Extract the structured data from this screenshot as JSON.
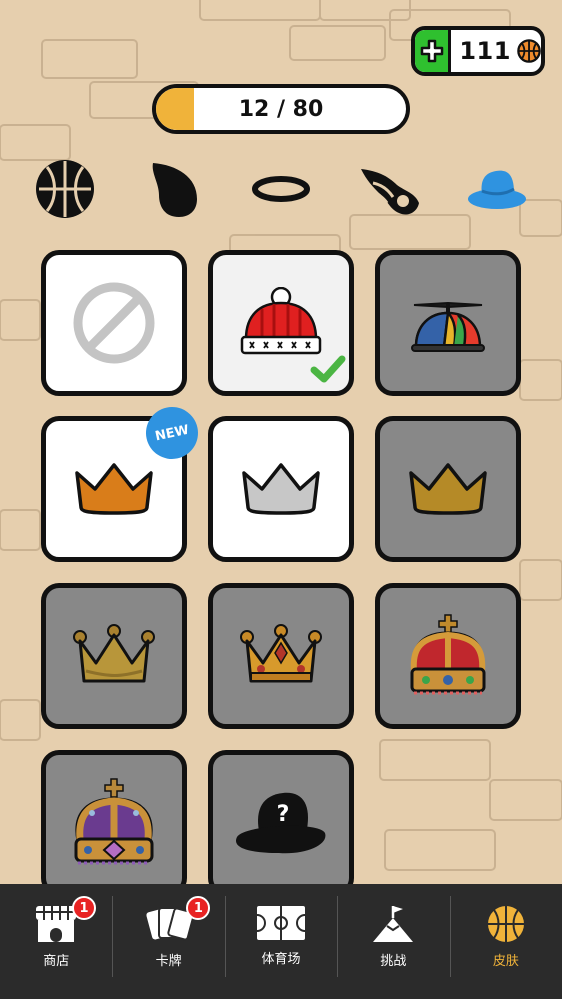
{
  "currency": {
    "amount": "111",
    "plus_icon": "plus-icon",
    "coin_icon": "basketball-icon"
  },
  "progress": {
    "text": "12 / 80",
    "collected": 12,
    "total": 80,
    "fill_color": "#f0b33a"
  },
  "categories": [
    {
      "name": "ball",
      "icon": "basketball-icon"
    },
    {
      "name": "shadow",
      "icon": "drop-shadow-icon"
    },
    {
      "name": "hoop",
      "icon": "ring-icon"
    },
    {
      "name": "fire",
      "icon": "flame-trail-icon"
    },
    {
      "name": "hat",
      "icon": "hat-icon",
      "selected": true,
      "selected_color": "#2f93e0"
    }
  ],
  "skins": [
    {
      "name": "none",
      "icon": "no-symbol-icon",
      "locked": false
    },
    {
      "name": "red-beanie",
      "icon": "beanie-icon",
      "locked": false,
      "equipped": true
    },
    {
      "name": "propeller-cap",
      "icon": "propeller-cap-icon",
      "locked": true
    },
    {
      "name": "orange-crown",
      "icon": "crown-icon",
      "locked": false,
      "new_badge": "NEW"
    },
    {
      "name": "silver-crown",
      "icon": "crown-icon",
      "locked": false
    },
    {
      "name": "gold-crown",
      "icon": "crown-icon",
      "locked": true
    },
    {
      "name": "ball-crown",
      "icon": "crown-icon",
      "locked": true
    },
    {
      "name": "jeweled-crown",
      "icon": "crown-icon",
      "locked": true
    },
    {
      "name": "royal-crown",
      "icon": "crown-icon",
      "locked": true
    },
    {
      "name": "imperial-crown",
      "icon": "crown-icon",
      "locked": true
    },
    {
      "name": "mystery-hat",
      "icon": "mystery-hat-icon",
      "locked": true,
      "mark": "?"
    }
  ],
  "nav": [
    {
      "label": "商店",
      "icon": "shop-icon",
      "badge": "1"
    },
    {
      "label": "卡牌",
      "icon": "cards-icon",
      "badge": "1"
    },
    {
      "label": "体育场",
      "icon": "court-icon"
    },
    {
      "label": "挑战",
      "icon": "mountain-flag-icon"
    },
    {
      "label": "皮肤",
      "icon": "basketball-icon",
      "active": true,
      "active_color": "#f0b33a"
    }
  ]
}
